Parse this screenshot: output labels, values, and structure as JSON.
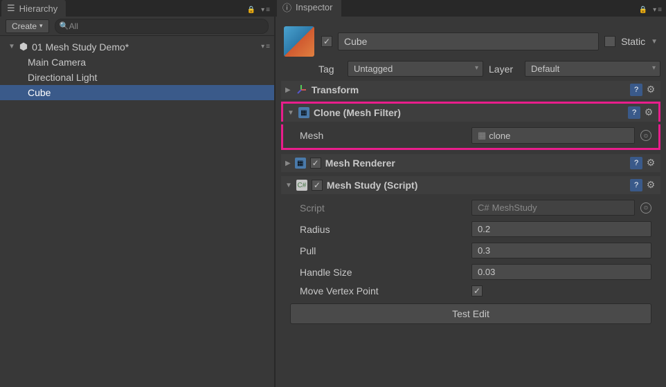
{
  "hierarchy": {
    "tab_title": "Hierarchy",
    "create_label": "Create",
    "search_placeholder": "All",
    "scene_name": "01 Mesh Study Demo*",
    "items": [
      "Main Camera",
      "Directional Light",
      "Cube"
    ],
    "selected_index": 2
  },
  "inspector": {
    "tab_title": "Inspector",
    "object_name": "Cube",
    "active": true,
    "static_label": "Static",
    "static_value": false,
    "tag_label": "Tag",
    "tag_value": "Untagged",
    "layer_label": "Layer",
    "layer_value": "Default",
    "components": {
      "transform": {
        "name": "Transform",
        "expanded": false
      },
      "mesh_filter": {
        "name": "Clone (Mesh Filter)",
        "expanded": true,
        "highlighted": true,
        "mesh_label": "Mesh",
        "mesh_value": "clone"
      },
      "mesh_renderer": {
        "name": "Mesh Renderer",
        "expanded": false,
        "enabled": true
      },
      "mesh_study": {
        "name": "Mesh Study (Script)",
        "expanded": true,
        "enabled": true,
        "script_label": "Script",
        "script_value": "MeshStudy",
        "radius_label": "Radius",
        "radius_value": "0.2",
        "pull_label": "Pull",
        "pull_value": "0.3",
        "handle_label": "Handle Size",
        "handle_value": "0.03",
        "move_vertex_label": "Move Vertex Point",
        "move_vertex_value": true,
        "button_label": "Test Edit"
      }
    }
  }
}
